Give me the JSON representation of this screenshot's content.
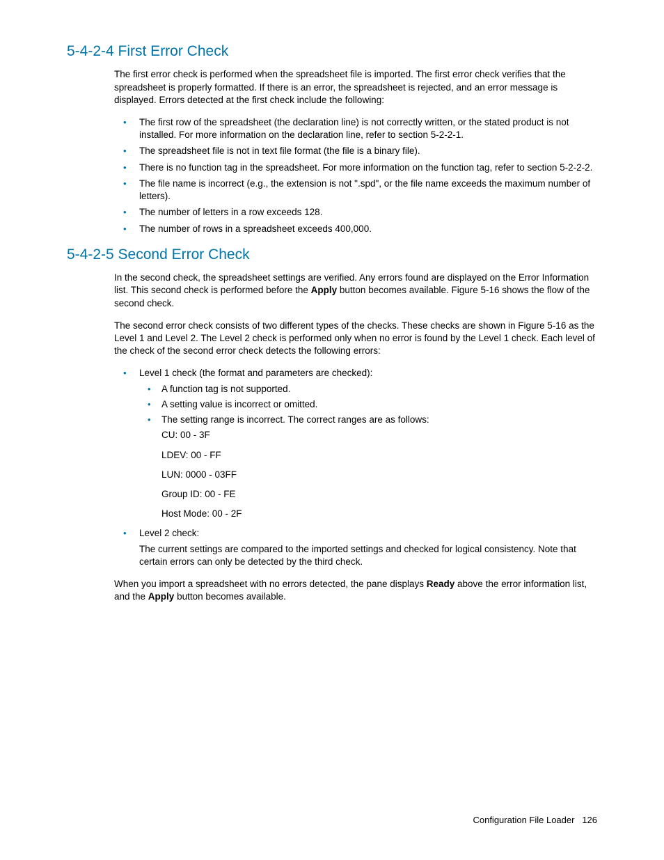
{
  "section1": {
    "heading": "5-4-2-4 First Error Check",
    "intro": "The first error check is performed when the spreadsheet file is imported. The first error check verifies that the spreadsheet is properly formatted. If there is an error, the spreadsheet is rejected, and an error message is displayed. Errors detected at the first check include the following:",
    "items": [
      "The first row of the spreadsheet (the declaration line) is not correctly written, or the stated product is not installed. For more information on the declaration line, refer to section 5-2-2-1.",
      "The spreadsheet file is not in text file format (the file is a binary file).",
      "There is no function tag in the spreadsheet. For more information on the function tag, refer to section 5-2-2-2.",
      "The file name is incorrect (e.g., the extension is not \".spd\", or the file name exceeds the maximum number of letters).",
      "The number of letters in a row exceeds 128.",
      "The number of rows in a spreadsheet exceeds 400,000."
    ]
  },
  "section2": {
    "heading": "5-4-2-5 Second Error Check",
    "p1a": "In the second check, the spreadsheet settings are verified. Any errors found are displayed on the Error Information list. This second check is performed before the ",
    "p1bold": "Apply",
    "p1b": " button becomes available. Figure 5-16 shows the flow of the second check.",
    "p2": "The second error check consists of two different types of the checks. These checks are shown in Figure 5-16 as the Level 1 and Level 2. The Level 2 check is performed only when no error is found by the Level 1 check. Each level of the check of the second error check detects the following errors:",
    "level1label": "Level 1 check (the format and parameters are checked):",
    "level1items": [
      "A function tag is not supported.",
      "A setting value is incorrect or omitted.",
      "The setting range is incorrect. The correct ranges are as follows:"
    ],
    "ranges": [
      "CU:  00 - 3F",
      "LDEV:  00 - FF",
      "LUN:  0000 - 03FF",
      "Group ID:  00 - FE",
      "Host Mode:  00 - 2F"
    ],
    "level2label": "Level 2 check:",
    "level2text": "The current settings are compared to the imported settings and checked for logical consistency. Note that certain errors can only be detected by the third check.",
    "p3a": "When you import a spreadsheet with no errors detected, the pane displays ",
    "p3bold1": "Ready",
    "p3b": " above the error information list, and the ",
    "p3bold2": "Apply",
    "p3c": " button becomes available."
  },
  "footer": {
    "title": "Configuration File Loader",
    "page": "126"
  }
}
